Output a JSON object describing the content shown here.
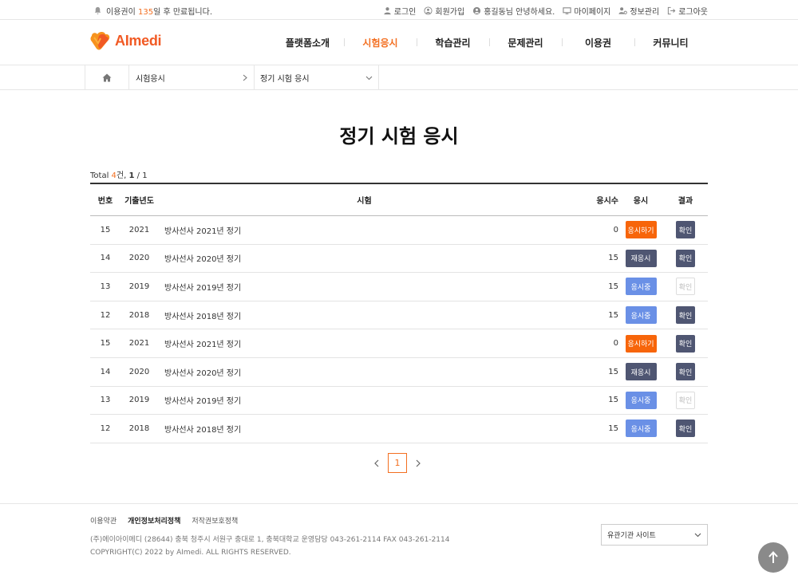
{
  "topbar": {
    "notice_pre": "이용권이 ",
    "notice_days": "135",
    "notice_post": "일 후 만료됩니다.",
    "links": [
      "로그인",
      "회원가입",
      "홍길동님 안녕하세요.",
      "마이페이지",
      "정보관리",
      "로그아웃"
    ]
  },
  "header": {
    "logo": "AImedi",
    "nav": [
      "플랫폼소개",
      "시험응시",
      "학습관리",
      "문제관리",
      "이용권",
      "커뮤니티"
    ]
  },
  "breadcrumb": {
    "level1": "시험응시",
    "level2": "정기 시험 응시"
  },
  "page": {
    "title": "정기 시험 응시"
  },
  "total": {
    "label": "Total ",
    "count": "4",
    "unit": "건, ",
    "page": "1",
    "sep": " / ",
    "pages": "1"
  },
  "table": {
    "headers": {
      "no": "번호",
      "year": "기출년도",
      "name": "시험",
      "count": "응시수",
      "exam": "응시",
      "result": "결과"
    },
    "rows": [
      {
        "no": "15",
        "year": "2021",
        "name": "방사선사 2021년 정기",
        "count": "0",
        "exam": "응시하기",
        "exam_style": "orange",
        "result": "확인",
        "result_style": "dark"
      },
      {
        "no": "14",
        "year": "2020",
        "name": "방사선사 2020년 정기",
        "count": "15",
        "exam": "재응시",
        "exam_style": "navy",
        "result": "확인",
        "result_style": "dark"
      },
      {
        "no": "13",
        "year": "2019",
        "name": "방사선사 2019년 정기",
        "count": "15",
        "exam": "응시중",
        "exam_style": "blue",
        "result": "확인",
        "result_style": "light"
      },
      {
        "no": "12",
        "year": "2018",
        "name": "방사선사 2018년 정기",
        "count": "15",
        "exam": "응시중",
        "exam_style": "blue",
        "result": "확인",
        "result_style": "dark"
      },
      {
        "no": "15",
        "year": "2021",
        "name": "방사선사 2021년 정기",
        "count": "0",
        "exam": "응시하기",
        "exam_style": "orange",
        "result": "확인",
        "result_style": "dark"
      },
      {
        "no": "14",
        "year": "2020",
        "name": "방사선사 2020년 정기",
        "count": "15",
        "exam": "재응시",
        "exam_style": "navy",
        "result": "확인",
        "result_style": "dark"
      },
      {
        "no": "13",
        "year": "2019",
        "name": "방사선사 2019년 정기",
        "count": "15",
        "exam": "응시중",
        "exam_style": "blue",
        "result": "확인",
        "result_style": "light"
      },
      {
        "no": "12",
        "year": "2018",
        "name": "방사선사 2018년 정기",
        "count": "15",
        "exam": "응시중",
        "exam_style": "blue",
        "result": "확인",
        "result_style": "dark"
      }
    ]
  },
  "pagination": {
    "current": "1"
  },
  "footer": {
    "links": [
      "이용약관",
      "개인정보처리정책",
      "저작권보호정책"
    ],
    "address": "(주)에이아이메디   (28644) 충북 청주시 서원구 충대로 1, 충북대학교   운영담당 043-261-2114   FAX 043-261-2114",
    "copyright": "COPYRIGHT(C) 2022 by AImedi.   ALL RIGHTS RESERVED.",
    "select": "유관기관 사이트"
  },
  "colors": {
    "accent": "#f36f21",
    "orange_btn": "#f7650a",
    "navy_btn": "#4f5672",
    "blue_btn": "#6a90e6"
  },
  "icons": [
    "bell-icon",
    "user-icon",
    "user-circle-icon",
    "monitor-icon",
    "user-gear-icon",
    "logout-icon",
    "home-icon",
    "chevron-right-icon",
    "chevron-down-icon",
    "arrow-up-icon"
  ]
}
